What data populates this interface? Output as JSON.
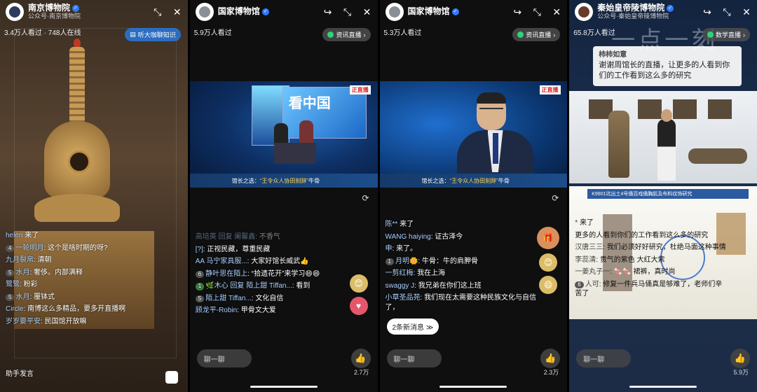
{
  "panels": [
    {
      "title": "南京博物院",
      "subtitle": "公众号·南京博物院",
      "viewers": "3.4万人看过 · 748人在线",
      "topbtn": "听大咖聊知识",
      "comments": [
        {
          "level": "",
          "user": "helen",
          "text": "来了"
        },
        {
          "level": "4",
          "user": "一轮明月",
          "text": "这个是啥时期的呀?"
        },
        {
          "level": "",
          "user": "九月裂帛",
          "text": "清朝"
        },
        {
          "level": "5",
          "user": "水月",
          "text": "奢侈。内部满释"
        },
        {
          "level": "",
          "user": "鹭鹭",
          "text": "粉彩"
        },
        {
          "level": "5",
          "user": "水月",
          "text": "覆钵式"
        },
        {
          "level": "",
          "user": "Circle",
          "text": "南博这么多精品，要多开直播啊"
        },
        {
          "level": "",
          "user": "岁岁要平安",
          "text": "民国馆开放嘛"
        }
      ],
      "chat_placeholder": "助手发言"
    },
    {
      "title": "国家博物馆",
      "viewers": "5.9万人看过",
      "topbtn": "资讯直播",
      "caption_pre": "馆长之选：",
      "caption_hl": "“王令众人协田刻辞”",
      "caption_post": "牛骨",
      "comments": [
        {
          "level": "",
          "user": "高培英 回复 阑馨鑫",
          "text": "不香气",
          "fade": true
        },
        {
          "level": "",
          "user": "[?]",
          "text": "正视民藏，尊重民藏"
        },
        {
          "level": "",
          "user": "AA 马宁家具服...",
          "text": "大家好馆长威武👍"
        },
        {
          "level": "6",
          "user": "静叶思在陌上",
          "text": "“拾遗花开”来学习😄😄"
        },
        {
          "level": "1",
          "user": "🌿木心 回复 陌上甜 Tiffan...",
          "text": "看到"
        },
        {
          "level": "5",
          "user": "陌上甜 Tiffan...",
          "text": "文化自信"
        },
        {
          "level": "",
          "user": "顾龙平-Robin",
          "text": "甲骨文大爱"
        }
      ],
      "chat_placeholder": "聊一聊",
      "likes": "2.7万"
    },
    {
      "title": "国家博物馆",
      "viewers": "5.3万人看过",
      "topbtn": "资讯直播",
      "caption_pre": "馆长之选：",
      "caption_hl": "“王令众人协田刻辞”",
      "caption_post": "牛骨",
      "comments": [
        {
          "level": "",
          "user": "陈**",
          "text": "来了"
        },
        {
          "level": "",
          "user": "WANG haiying",
          "text": "证古泽今"
        },
        {
          "level": "",
          "user": "申",
          "text": "来了。"
        },
        {
          "level": "1",
          "user": "月明🌼",
          "text": "牛骨：牛的肩胛骨"
        },
        {
          "level": "",
          "user": "一剪红梅",
          "text": "我在上海"
        },
        {
          "level": "",
          "user": "swaggy J",
          "text": "我兄弟在你们这上班"
        },
        {
          "level": "",
          "user": "小草圣品苑",
          "text": "我们现在太需要这种民族文化与自信了，"
        }
      ],
      "new_messages": "2条新消息 ≫",
      "chat_placeholder": "聊一聊",
      "likes": "2.3万"
    },
    {
      "title": "秦始皇帝陵博物院",
      "subtitle": "公众号·秦始皇帝陵博物院",
      "viewers": "65.8万人看过",
      "topbtn": "数学直播",
      "watermark": "一点一刻",
      "quote_user": "柿柿如意",
      "quote_text": "谢谢周馆长的直播，让更多的人看到你们的工作看到这么多的研究",
      "banner_title": "K9901坑出土4号俑百戏俑胸肌及布料纹饰研究",
      "comments": [
        {
          "level": "",
          "user": "*",
          "text": "来了"
        },
        {
          "level": "",
          "user": "",
          "text": "更多的人看到你们的工作看到这么多的研究"
        },
        {
          "level": "",
          "user": "汉唐三三",
          "text": "我们必须好好研究，杜绝马面这种事情"
        },
        {
          "level": "",
          "user": "李蕊清",
          "text": "贵气的紫色 大红大紫"
        },
        {
          "level": "",
          "user": "一姜丸子一",
          "text": "🍬🍬 裙裤，真时尚"
        },
        {
          "level": "6",
          "user": "人可",
          "text": "修复一件兵马俑真是够难了，老师们辛苦了"
        }
      ],
      "chat_placeholder": "聊一聊",
      "likes": "5.9万"
    }
  ],
  "icons": {
    "share": "share-icon",
    "shrink": "minimize-icon",
    "close": "close-icon",
    "like": "thumb-up-icon"
  }
}
